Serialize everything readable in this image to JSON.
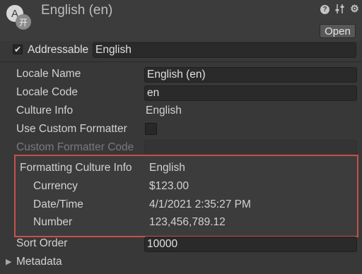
{
  "header": {
    "title": "English (en)",
    "icon_glyph_primary": "A",
    "icon_glyph_secondary": "开",
    "open_label": "Open",
    "icons": [
      "help-icon",
      "presets-icon",
      "gear-icon"
    ]
  },
  "addressable": {
    "label": "Addressable",
    "checked": true,
    "value": "English"
  },
  "fields": {
    "locale_name": {
      "label": "Locale Name",
      "value": "English (en)"
    },
    "locale_code": {
      "label": "Locale Code",
      "value": "en"
    },
    "culture_info": {
      "label": "Culture Info",
      "value": "English"
    },
    "use_custom_formatter": {
      "label": "Use Custom Formatter",
      "checked": false
    },
    "custom_formatter_code": {
      "label": "Custom Formatter Code",
      "value": ""
    }
  },
  "formatting": {
    "label": "Formatting Culture Info",
    "value": "English",
    "currency": {
      "label": "Currency",
      "value": "$123.00"
    },
    "datetime": {
      "label": "Date/Time",
      "value": "4/1/2021 2:35:27 PM"
    },
    "number": {
      "label": "Number",
      "value": "123,456,789.12"
    },
    "highlight_color": "#c4514a"
  },
  "sort_order": {
    "label": "Sort Order",
    "value": "10000"
  },
  "metadata": {
    "label": "Metadata",
    "expanded": false
  }
}
